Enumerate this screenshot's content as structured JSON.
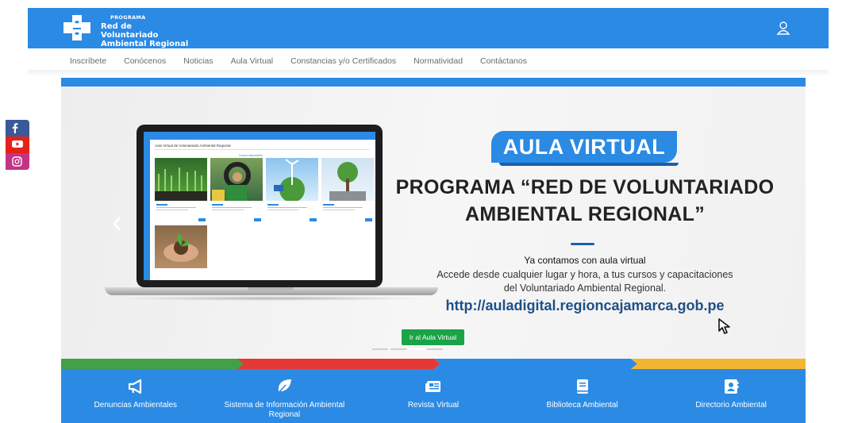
{
  "header": {
    "logo_small": "PROGRAMA",
    "logo_line1": "Red de Voluntariado",
    "logo_line2": "Ambiental Regional"
  },
  "nav": {
    "items": [
      {
        "label": "Inscríbete"
      },
      {
        "label": "Conócenos"
      },
      {
        "label": "Noticias"
      },
      {
        "label": "Aula Virtual"
      },
      {
        "label": "Constancias y/o Certificados"
      },
      {
        "label": "Normatividad"
      },
      {
        "label": "Contáctanos"
      }
    ]
  },
  "social": [
    "facebook-icon",
    "youtube-icon",
    "instagram-icon"
  ],
  "banner": {
    "tag": "AULA VIRTUAL",
    "headline_line1": "PROGRAMA “RED DE VOLUNTARIADO",
    "headline_line2": "AMBIENTAL REGIONAL”",
    "lead": "Ya contamos con aula virtual",
    "desc_line1": "Accede desde cualquier lugar y hora, a tus cursos y capacitaciones",
    "desc_line2": "del Voluntariado Ambiental Regional.",
    "url": "http://auladigital.regioncajamarca.gob.pe",
    "cta": "Ir al Aula Virtual",
    "screen_title": "Aula Virtual de Voluntariado Ambiental Regional",
    "screen_sub": "Cursos disponibles",
    "slides": 4,
    "active_slide": 3
  },
  "colors": {
    "primary": "#2b8ae4",
    "green": "#1aa348",
    "strip": [
      "#43a047",
      "#e53935",
      "#2b8ae4",
      "#f2b632"
    ]
  },
  "tiles": [
    {
      "label": "Denuncias Ambientales",
      "icon": "megaphone-icon"
    },
    {
      "label": "Sistema de Información Ambiental Regional",
      "icon": "leaf-icon"
    },
    {
      "label": "Revista Virtual",
      "icon": "newspaper-icon"
    },
    {
      "label": "Biblioteca Ambiental",
      "icon": "book-icon"
    },
    {
      "label": "Directorio Ambiental",
      "icon": "contact-book-icon"
    }
  ]
}
